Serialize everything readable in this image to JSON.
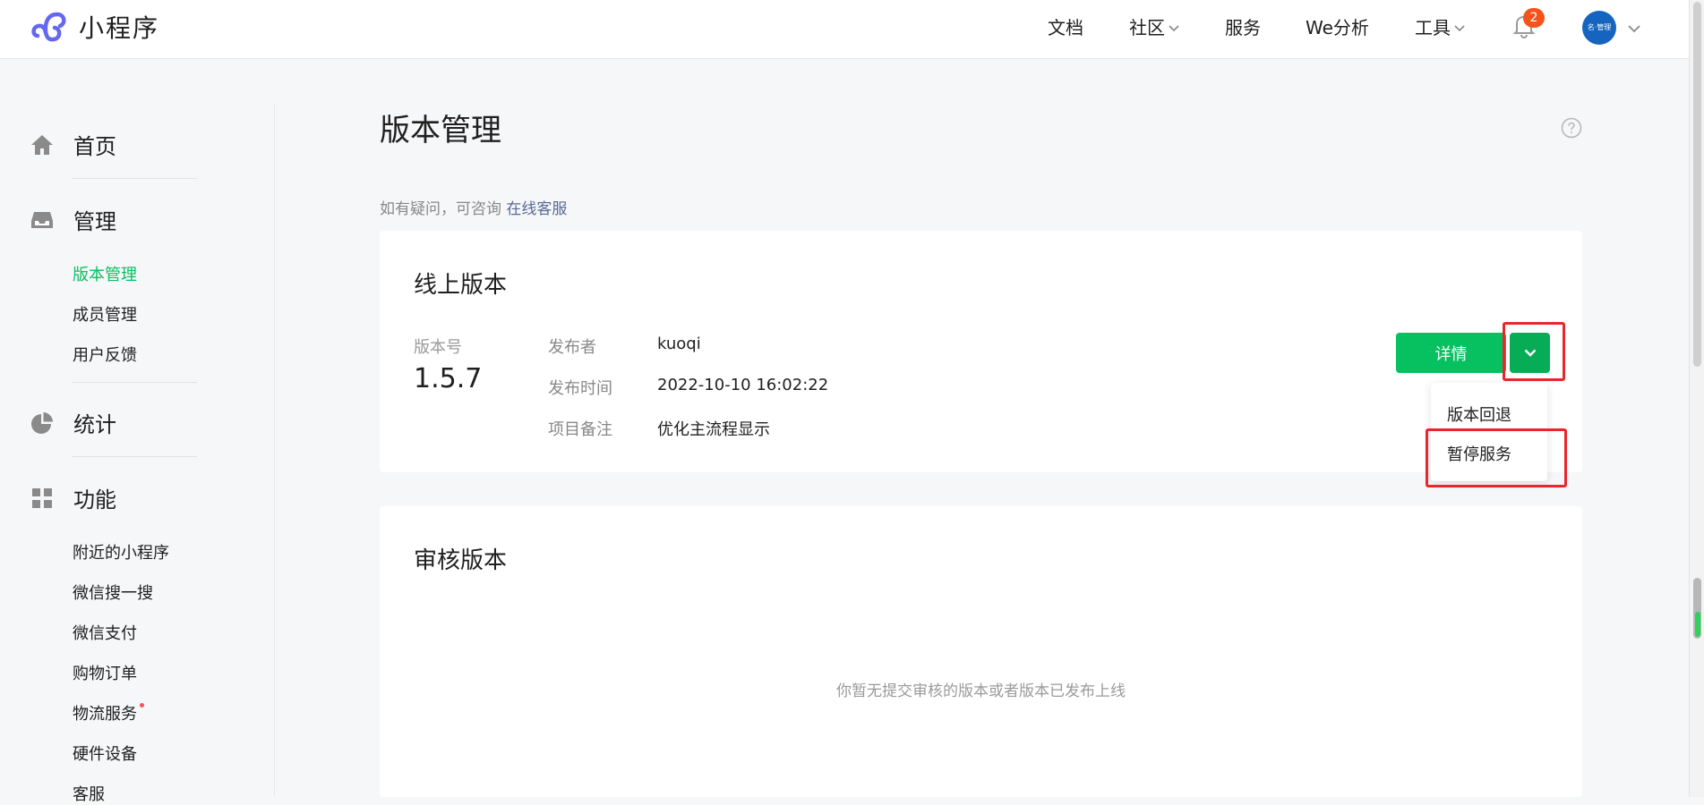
{
  "app": {
    "logo_text": "小程序",
    "brand_color": "#07c160"
  },
  "topnav": {
    "items": [
      {
        "label": "文档",
        "has_dropdown": false
      },
      {
        "label": "社区",
        "has_dropdown": true
      },
      {
        "label": "服务",
        "has_dropdown": false
      },
      {
        "label": "We分析",
        "has_dropdown": false
      },
      {
        "label": "工具",
        "has_dropdown": true
      }
    ],
    "notification_count": "2",
    "avatar_text": "名·管理"
  },
  "sidebar": {
    "sections": [
      {
        "label": "首页",
        "icon": "home-icon",
        "items": []
      },
      {
        "label": "管理",
        "icon": "inbox-icon",
        "items": [
          "版本管理",
          "成员管理",
          "用户反馈"
        ],
        "active_item": "版本管理"
      },
      {
        "label": "统计",
        "icon": "pie-chart-icon",
        "items": []
      },
      {
        "label": "功能",
        "icon": "grid-icon",
        "items": [
          "附近的小程序",
          "微信搜一搜",
          "微信支付",
          "购物订单",
          "物流服务",
          "硬件设备",
          "客服"
        ],
        "dot_item": "物流服务"
      }
    ]
  },
  "main": {
    "page_title": "版本管理",
    "consult_prefix": "如有疑问，可咨询",
    "consult_link": "在线客服",
    "online": {
      "title": "线上版本",
      "version_label": "版本号",
      "version_number": "1.5.7",
      "publisher_label": "发布者",
      "publisher": "kuoqi",
      "time_label": "发布时间",
      "time": "2022-10-10 16:02:22",
      "note_label": "项目备注",
      "note": "优化主流程显示",
      "detail_button": "详情",
      "dropdown_items": [
        "版本回退",
        "暂停服务"
      ]
    },
    "review": {
      "title": "审核版本",
      "empty_text": "你暂无提交审核的版本或者版本已发布上线"
    }
  },
  "colors": {
    "accent_green": "#07c160",
    "link_blue": "#576b95",
    "highlight_red": "#e8262b",
    "badge_orange": "#f4541c"
  }
}
